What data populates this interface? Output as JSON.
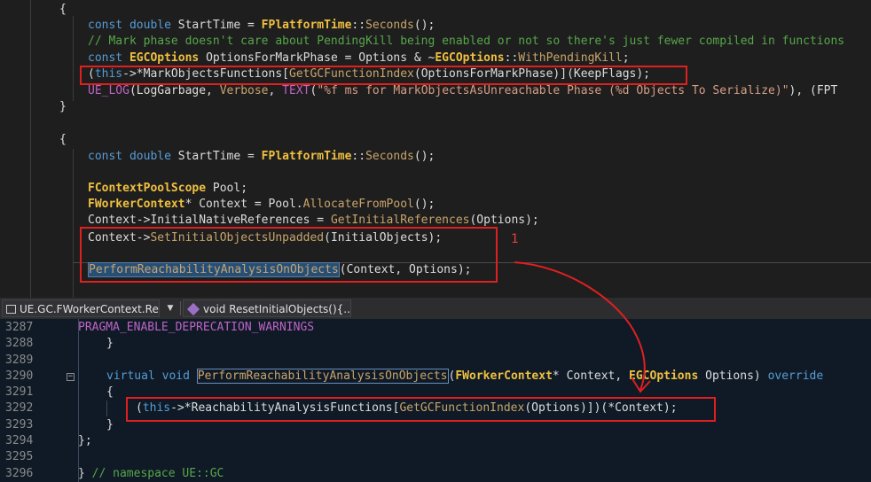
{
  "top_code": {
    "l1": "{",
    "l2_kw": "const double",
    "l2_a": " StartTime = ",
    "l2_ty": "FPlatformTime",
    "l2_b": "::",
    "l2_fn": "Seconds",
    "l2_c": "();",
    "l3": "// Mark phase doesn't care about PendingKill being enabled or not so there's just fewer compiled in functions",
    "l4_kw": "const",
    "l4_ty": "EGCOptions",
    "l4_a": " OptionsForMarkPhase = Options & ~",
    "l4_ty2": "EGCOptions",
    "l4_b": "::",
    "l4_en": "WithPendingKill",
    "l4_c": ";",
    "l5_a": "(",
    "l5_kw": "this",
    "l5_b": "->*",
    "l5_var": "MarkObjectsFunctions",
    "l5_c": "[",
    "l5_fn": "GetGCFunctionIndex",
    "l5_d": "(OptionsForMarkPhase)](KeepFlags);",
    "l6_mac": "UE_LOG",
    "l6_a": "(LogGarbage, ",
    "l6_en": "Verbose",
    "l6_b": ", ",
    "l6_mac2": "TEXT",
    "l6_c": "(",
    "l6_str": "\"%f ms for MarkObjectsAsUnreachable Phase (%d Objects To Serialize)\"",
    "l6_d": "), (FPT",
    "l7": "}",
    "l8": "{",
    "l9_kw": "const double",
    "l9_a": " StartTime = ",
    "l9_ty": "FPlatformTime",
    "l9_b": "::",
    "l9_fn": "Seconds",
    "l9_c": "();",
    "l10_ty": "FContextPoolScope",
    "l10_a": " Pool;",
    "l11_ty": "FWorkerContext",
    "l11_a": "* Context = Pool.",
    "l11_fn": "AllocateFromPool",
    "l11_b": "();",
    "l12_a": "Context->InitialNativeReferences = ",
    "l12_fn": "GetInitialReferences",
    "l12_b": "(Options);",
    "l13_a": "Context->",
    "l13_fn": "SetInitialObjectsUnpadded",
    "l13_b": "(InitialObjects);",
    "l14_fn": "PerformReachabilityAnalysisOnObjects",
    "l14_a": "(Context, Options);"
  },
  "annotation": {
    "number": "1",
    "box_color": "#e01f1f"
  },
  "toolbar": {
    "file_combo": "UE.GC.FWorkerContext.Res",
    "member_combo": "void ResetInitialObjects(){...}"
  },
  "bottom_code": {
    "numbers": [
      "3287",
      "3288",
      "3289",
      "3290",
      "3291",
      "3292",
      "3293",
      "3294",
      "3295",
      "3296"
    ],
    "b1_mac": "PRAGMA_ENABLE_DEPRECATION_WARNINGS",
    "b2": "}",
    "b4_kw": "virtual void",
    "b4_fn": "PerformReachabilityAnalysisOnObjects",
    "b4_a": "(",
    "b4_ty": "FWorkerContext",
    "b4_b": "* Context, ",
    "b4_ty2": "EGCOptions",
    "b4_c": " Options) ",
    "b4_kw2": "override",
    "b5": "{",
    "b6_a": "(",
    "b6_kw": "this",
    "b6_b": "->*",
    "b6_var": "ReachabilityAnalysisFunctions",
    "b6_c": "[",
    "b6_fn": "GetGCFunctionIndex",
    "b6_d": "(Options)])(*Context);",
    "b7": "}",
    "b8": "};",
    "b10_a": "} ",
    "b10_cm": "// namespace UE::GC"
  }
}
